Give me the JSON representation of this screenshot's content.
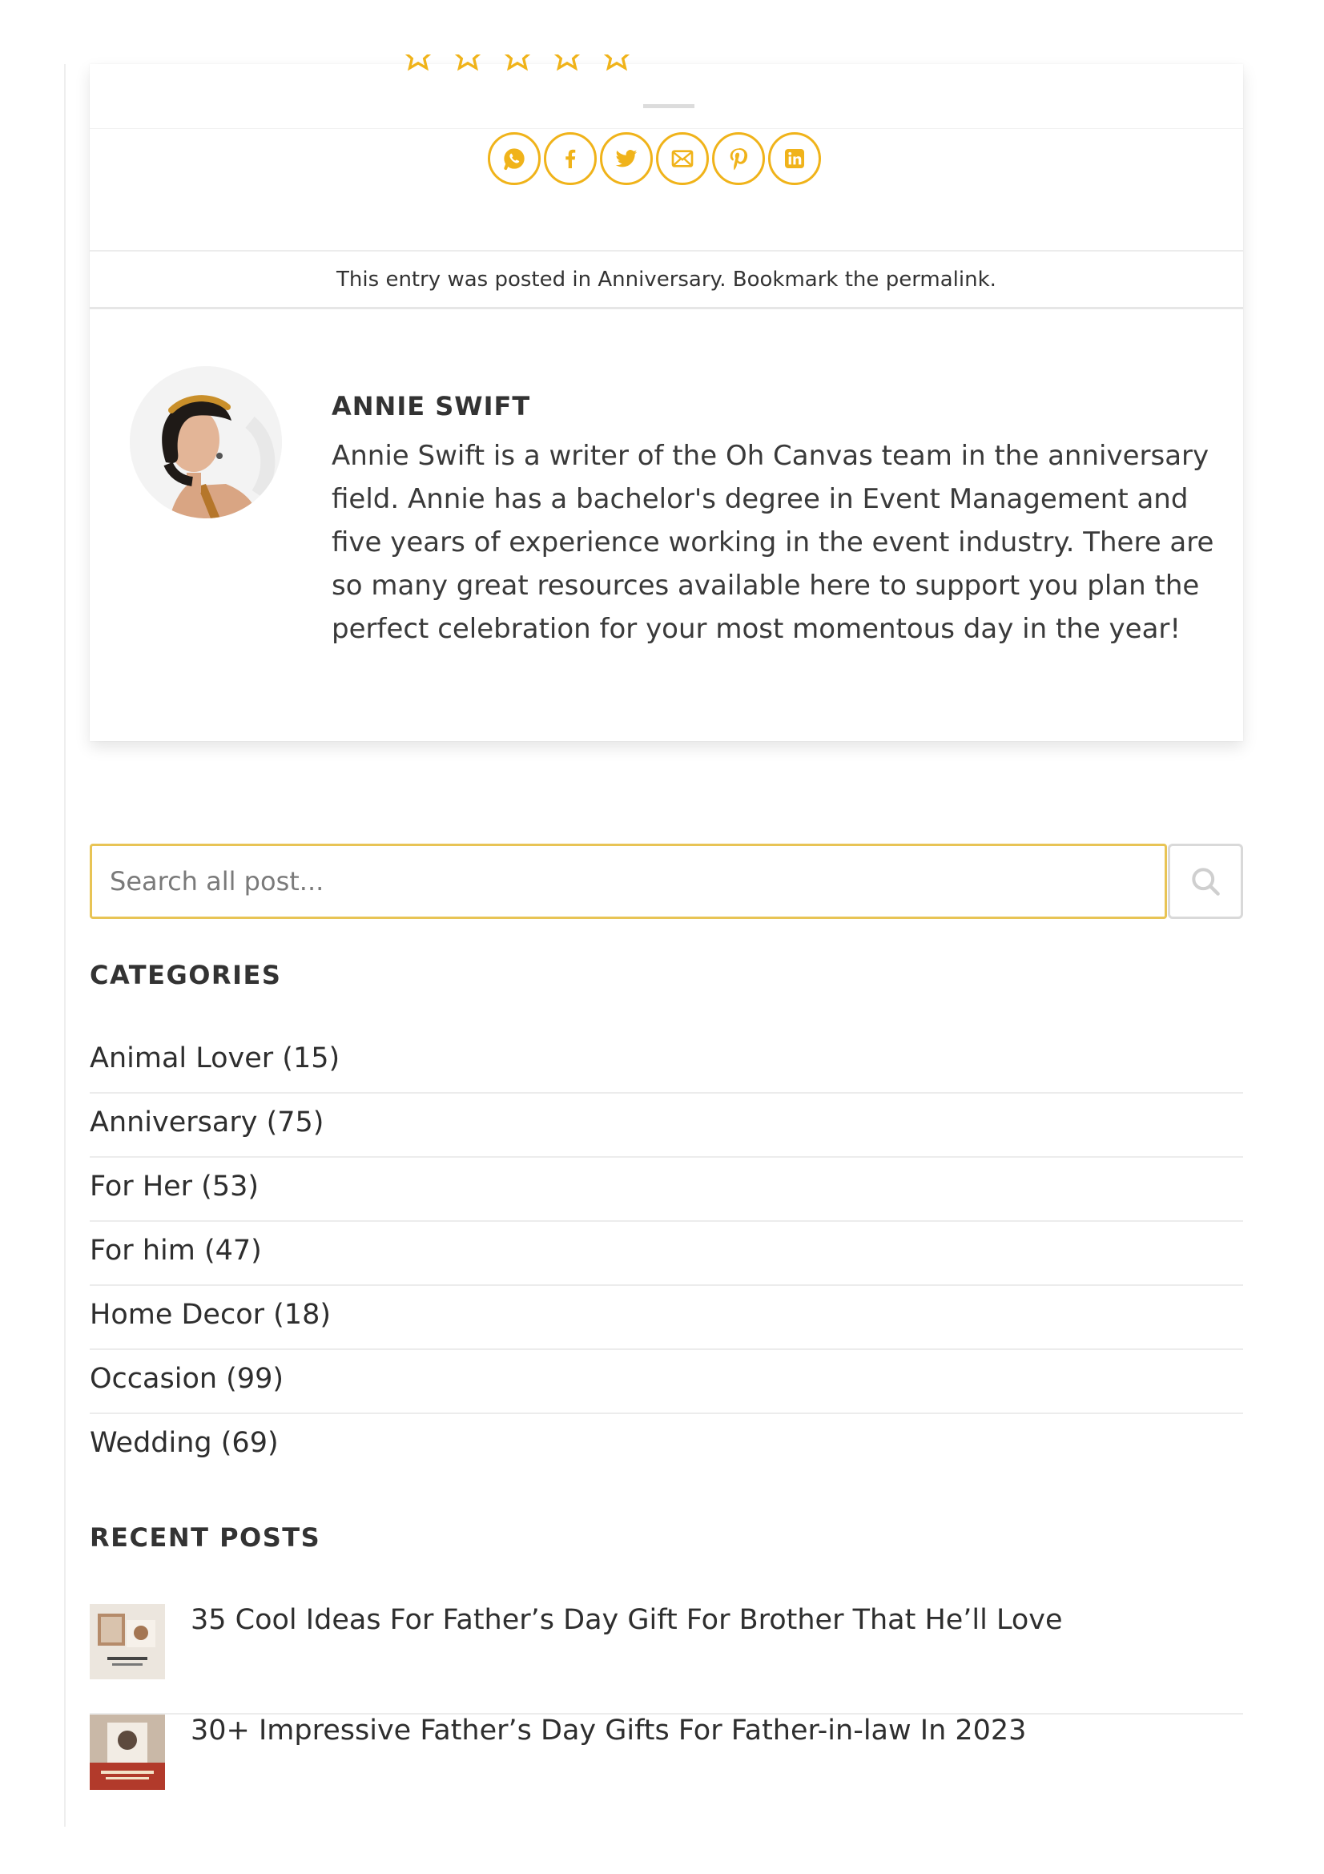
{
  "colors": {
    "accent": "#f0b31a",
    "search_border": "#e8c455",
    "text": "#2e2e2e",
    "divider": "#ececec"
  },
  "share": {
    "buttons": [
      {
        "icon": "whatsapp-icon"
      },
      {
        "icon": "facebook-icon"
      },
      {
        "icon": "twitter-icon"
      },
      {
        "icon": "email-icon"
      },
      {
        "icon": "pinterest-icon"
      },
      {
        "icon": "linkedin-icon"
      }
    ]
  },
  "entry_meta": {
    "prefix": "This entry was posted in ",
    "category_link": "Anniversary",
    "middle": ". Bookmark the ",
    "permalink_link": "permalink",
    "suffix": "."
  },
  "author": {
    "name": "ANNIE SWIFT",
    "bio": "Annie Swift is a writer of the Oh Canvas team in the anniversary field. Annie has a bachelor's degree in Event Management and five years of experience working in the event industry. There are so many great resources available here to support you plan the perfect celebration for your most momentous day in the year!"
  },
  "search": {
    "placeholder": "Search all post..."
  },
  "categories": {
    "title": "CATEGORIES",
    "items": [
      {
        "label": "Animal Lover (15)"
      },
      {
        "label": "Anniversary (75)"
      },
      {
        "label": "For Her (53)"
      },
      {
        "label": "For him (47)"
      },
      {
        "label": "Home Decor (18)"
      },
      {
        "label": "Occasion (99)"
      },
      {
        "label": "Wedding (69)"
      }
    ]
  },
  "recent_posts": {
    "title": "RECENT POSTS",
    "items": [
      {
        "title": "35 Cool Ideas For Father’s Day Gift For Brother That He’ll Love"
      },
      {
        "title": "30+ Impressive Father’s Day Gifts For Father-in-law In 2023"
      }
    ]
  }
}
